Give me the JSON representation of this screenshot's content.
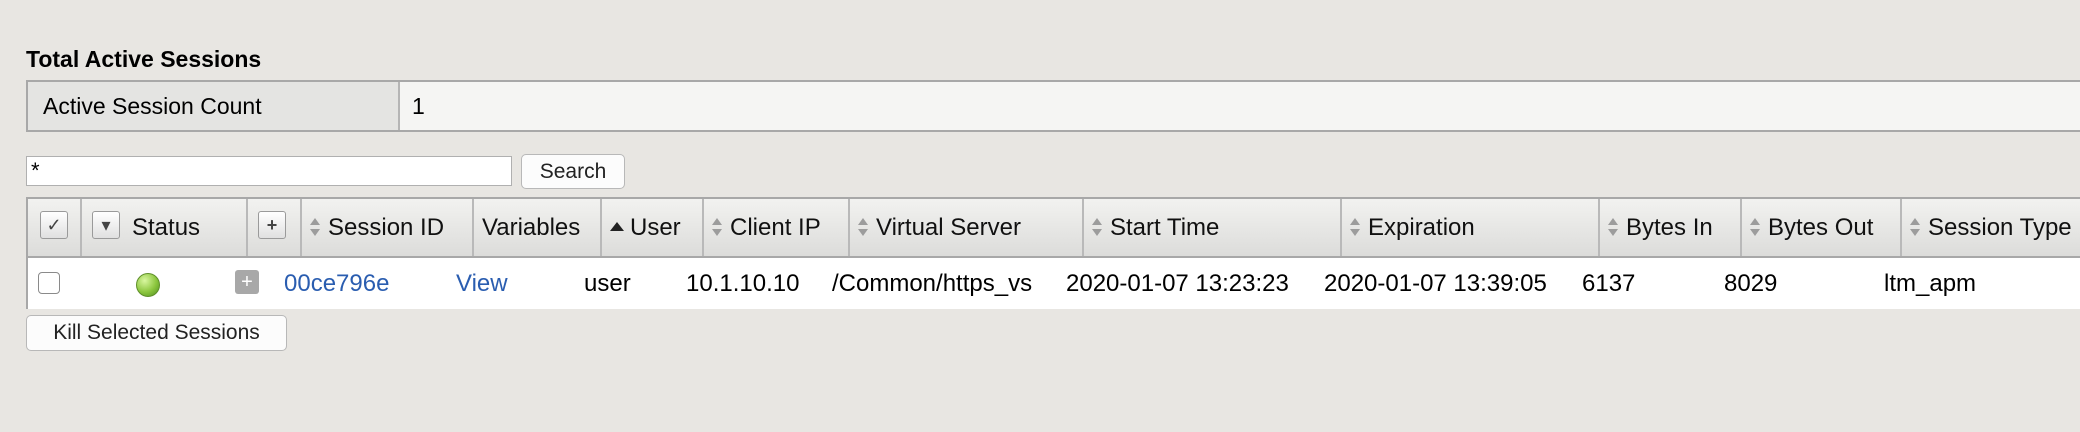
{
  "section": {
    "title": "Total Active Sessions"
  },
  "summary": {
    "label": "Active Session Count",
    "value": "1"
  },
  "search": {
    "value": "*",
    "button_label": "Search"
  },
  "table": {
    "columns": {
      "status": "Status",
      "session_id": "Session ID",
      "variables": "Variables",
      "user": "User",
      "client_ip": "Client IP",
      "virtual_server": "Virtual Server",
      "start_time": "Start Time",
      "expiration": "Expiration",
      "bytes_in": "Bytes In",
      "bytes_out": "Bytes Out",
      "session_type": "Session Type"
    },
    "rows": [
      {
        "status": "active",
        "session_id": "00ce796e",
        "variables": "View",
        "user": "user",
        "client_ip": "10.1.10.10",
        "virtual_server": "/Common/https_vs",
        "start_time": "2020-01-07 13:23:23",
        "expiration": "2020-01-07 13:39:05",
        "bytes_in": "6137",
        "bytes_out": "8029",
        "session_type": "ltm_apm"
      }
    ]
  },
  "actions": {
    "kill_label": "Kill Selected Sessions"
  },
  "icons": {
    "select_all": "checkbox-checked-icon",
    "status_menu": "chevron-down-icon",
    "expand_all": "plus-icon",
    "sort": "sort-icon",
    "sort_asc": "sort-ascending-icon",
    "status": "green-status-icon",
    "expand_row": "plus-icon"
  },
  "colors": {
    "link": "#2a5db0",
    "status_active": "#8cc63e"
  }
}
